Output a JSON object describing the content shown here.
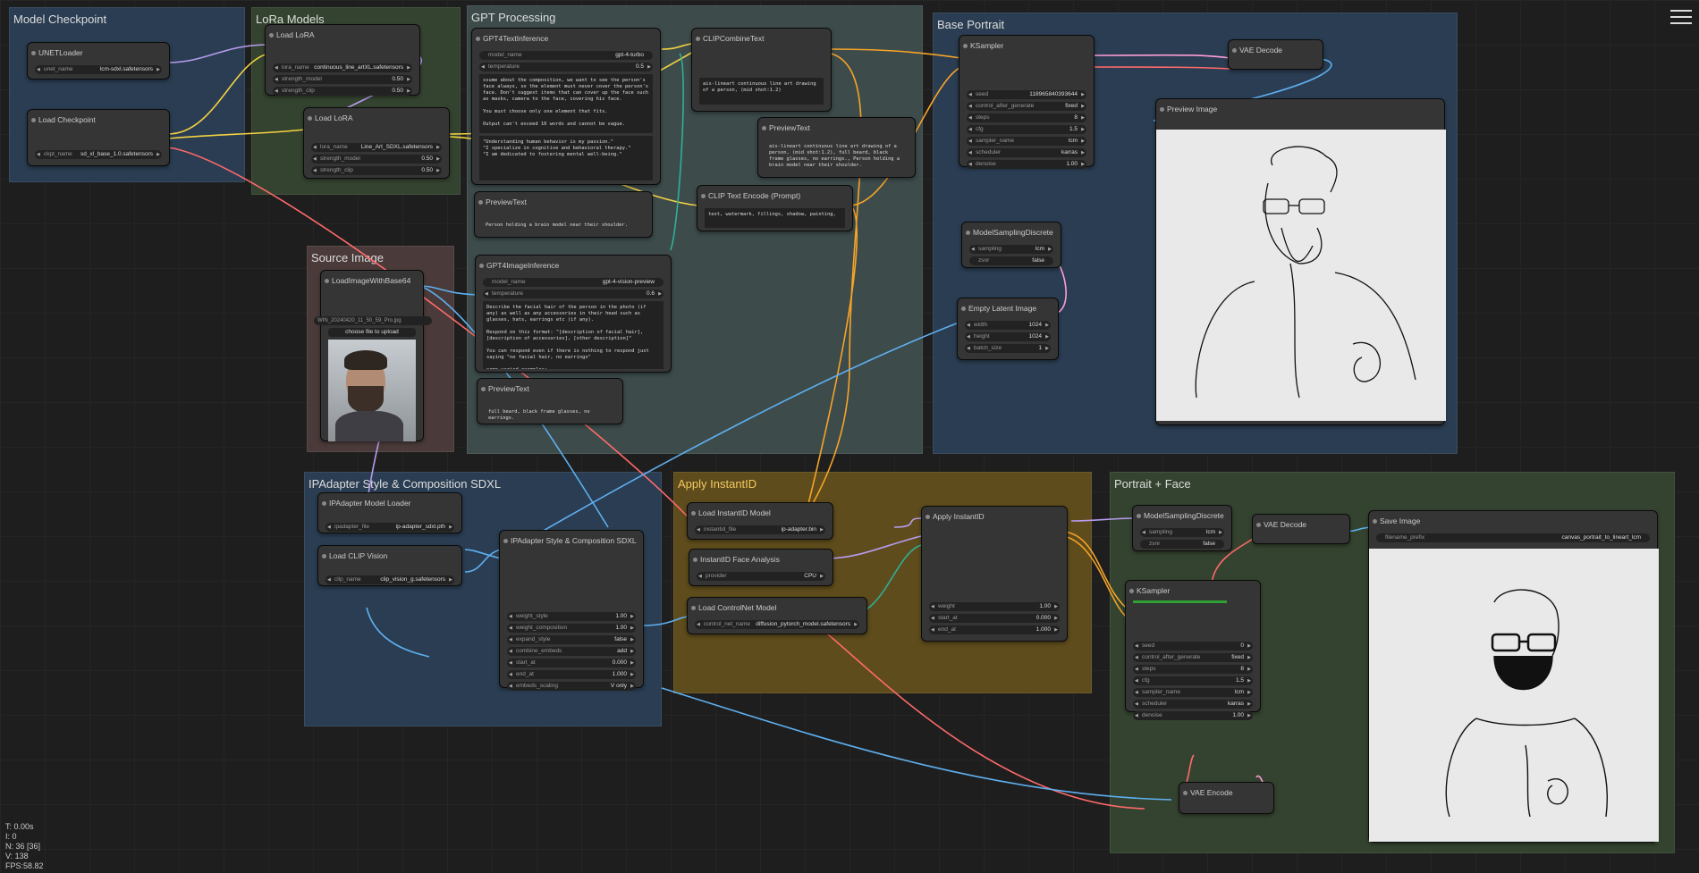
{
  "groups": {
    "model_checkpoint": "Model Checkpoint",
    "lora_models": "LoRa Models",
    "gpt_processing": "GPT Processing",
    "base_portrait": "Base Portrait",
    "source_image": "Source Image",
    "ipadapter": "IPAdapter Style & Composition SDXL",
    "apply_instantid": "Apply InstantID",
    "portrait_face": "Portrait + Face"
  },
  "colors": {
    "model_group": "#2a3d52",
    "lora_group": "#34432f",
    "gpt_group": "#3d4b4b",
    "base_group": "#2a3d52",
    "source_group": "#4a3b3a",
    "ipa_group": "#2a3d52",
    "instantid_group": "#5e4c1c",
    "face_group": "#34432f",
    "link_clip": "#f4d242",
    "link_model": "#b79cf0",
    "link_vae": "#ff6a6a",
    "link_image": "#5fb0f0",
    "link_cond": "#f7a428",
    "link_latent": "#ff9fd6",
    "link_green": "#2fb098"
  },
  "nodes": {
    "unet_loader": {
      "title": "UNETLoader",
      "w_unet_name": "unet_name",
      "v_unet_name": "lcm-sdxl.safetensors"
    },
    "load_checkpoint": {
      "title": "Load Checkpoint",
      "w_ckpt_name": "ckpt_name",
      "v_ckpt_name": "sd_xl_base_1.0.safetensors"
    },
    "load_lora_1": {
      "title": "Load LoRA",
      "w_lora": "lora_name",
      "v_lora": "continuous_line_artXL.safetensors",
      "w_sm": "strength_model",
      "v_sm": "0.50",
      "w_sc": "strength_clip",
      "v_sc": "0.50"
    },
    "load_lora_2": {
      "title": "Load LoRA",
      "w_lora": "lora_name",
      "v_lora": "Line_Art_SDXL.safetensors",
      "w_sm": "strength_model",
      "v_sm": "0.50",
      "w_sc": "strength_clip",
      "v_sc": "0.50"
    },
    "gpt4_text": {
      "title": "GPT4TextInference",
      "w_model": "model_name",
      "v_model": "gpt-4-turbo",
      "w_temp": "temperature",
      "v_temp": "0.5",
      "prompt": "ssume about the composition, we want to see the person's face always, so the element must never cover the person's face. Don't suggest items that can cover up the face such as masks, camera to the face, covering his face.\n\nYou must choose only one element that fits.\n\nOutput can't exceed 10 words and cannot be vague.",
      "quotes": "\"Understanding human behavior is my passion.\"\n\"I specialize in cognitive and behavioral therapy.\"\n\"I am dedicated to fostering mental well-being.\""
    },
    "clip_combine": {
      "title": "CLIPCombineText",
      "text": "ais-lineart continuous line art drawing of a person, (mid shot:1.2)"
    },
    "preview_text_main": {
      "title": "PreviewText",
      "text": "ais-lineart continuous line art drawing of a person, (mid shot:1.2), full beard, black frame glasses, no earrings., Person holding a brain model near their shoulder."
    },
    "preview_text_1": {
      "title": "PreviewText",
      "text": "Person holding a brain model near their shoulder."
    },
    "clip_text_encode": {
      "title": "CLIP Text Encode (Prompt)",
      "text": "text, watermark, fillings, shadow, painting,"
    },
    "gpt4_image": {
      "title": "GPT4ImageInference",
      "w_model": "model_name",
      "v_model": "gpt-4-vision-preview",
      "w_temp": "temperature",
      "v_temp": "0.6",
      "prompt": "Describe the facial hair of the person in the photo (if any) as well as any accessories in their head such as glasses, hats, earrings etc (if any).\n\nRespond on this format: \"[description of facial hair], [description of accessories], [other description]\"\n\nYou can respond even if there is nothing to respond just saying \"no facial hair, no earrings\"\n\nsome varied examples:"
    },
    "preview_text_2": {
      "title": "PreviewText",
      "text": "full beard, black frame glasses, no earrings."
    },
    "load_image": {
      "title": "LoadImageWithBase64",
      "w_image": "WIN_20240420_11_50_59_Pro.jpg",
      "upload": "choose file to upload"
    },
    "ksampler_base": {
      "title": "KSampler",
      "rows": [
        [
          "seed",
          "118965840393644"
        ],
        [
          "control_after_generate",
          "fixed"
        ],
        [
          "steps",
          "8"
        ],
        [
          "cfg",
          "1.5"
        ],
        [
          "sampler_name",
          "lcm"
        ],
        [
          "scheduler",
          "karras"
        ],
        [
          "denoise",
          "1.00"
        ]
      ]
    },
    "vae_decode_base": {
      "title": "VAE Decode"
    },
    "preview_image": {
      "title": "Preview Image"
    },
    "model_sampling_base": {
      "title": "ModelSamplingDiscrete",
      "w_sampling": "sampling",
      "v_sampling": "lcm",
      "w_zsnr": "zsnr",
      "v_zsnr": "false"
    },
    "empty_latent": {
      "title": "Empty Latent Image",
      "rows": [
        [
          "width",
          "1024"
        ],
        [
          "height",
          "1024"
        ],
        [
          "batch_size",
          "1"
        ]
      ]
    },
    "ipa_loader": {
      "title": "IPAdapter Model Loader",
      "w": "ipadapter_file",
      "v": "ip-adapter_sdxl.pth"
    },
    "clip_vision": {
      "title": "Load CLIP Vision",
      "w": "clip_name",
      "v": "clip_vision_g.safetensors"
    },
    "ipa_style": {
      "title": "IPAdapter Style & Composition SDXL",
      "rows": [
        [
          "weight_style",
          "1.00"
        ],
        [
          "weight_composition",
          "1.00"
        ],
        [
          "expand_style",
          "false"
        ],
        [
          "combine_embeds",
          "add"
        ],
        [
          "start_at",
          "0.000"
        ],
        [
          "end_at",
          "1.000"
        ],
        [
          "embeds_scaling",
          "V only"
        ]
      ]
    },
    "instantid_model": {
      "title": "Load InstantID Model",
      "w": "instantid_file",
      "v": "ip-adapter.bin"
    },
    "instantid_face": {
      "title": "InstantID Face Analysis",
      "w": "provider",
      "v": "CPU"
    },
    "controlnet": {
      "title": "Load ControlNet Model",
      "w": "control_net_name",
      "v": "diffusion_pytorch_model.safetensors"
    },
    "apply_instantid": {
      "title": "Apply InstantID",
      "rows": [
        [
          "weight",
          "1.00"
        ],
        [
          "start_at",
          "0.000"
        ],
        [
          "end_at",
          "1.000"
        ]
      ]
    },
    "model_sampling_face": {
      "title": "ModelSamplingDiscrete",
      "w_sampling": "sampling",
      "v_sampling": "lcm",
      "w_zsnr": "zsnr",
      "v_zsnr": "false"
    },
    "vae_decode_face": {
      "title": "VAE Decode"
    },
    "save_image": {
      "title": "Save Image",
      "w": "filename_prefix",
      "v": "canvas_portrait_to_lineart_lcm"
    },
    "ksampler_face": {
      "title": "KSampler",
      "rows": [
        [
          "seed",
          "0"
        ],
        [
          "control_after_generate",
          "fixed"
        ],
        [
          "steps",
          "8"
        ],
        [
          "cfg",
          "1.5"
        ],
        [
          "sampler_name",
          "lcm"
        ],
        [
          "scheduler",
          "karras"
        ],
        [
          "denoise",
          "1.00"
        ]
      ]
    },
    "vae_encode": {
      "title": "VAE Encode"
    }
  },
  "status": [
    "T: 0.00s",
    "I: 0",
    "N: 36 [36]",
    "V: 138",
    "FPS:58.82"
  ]
}
